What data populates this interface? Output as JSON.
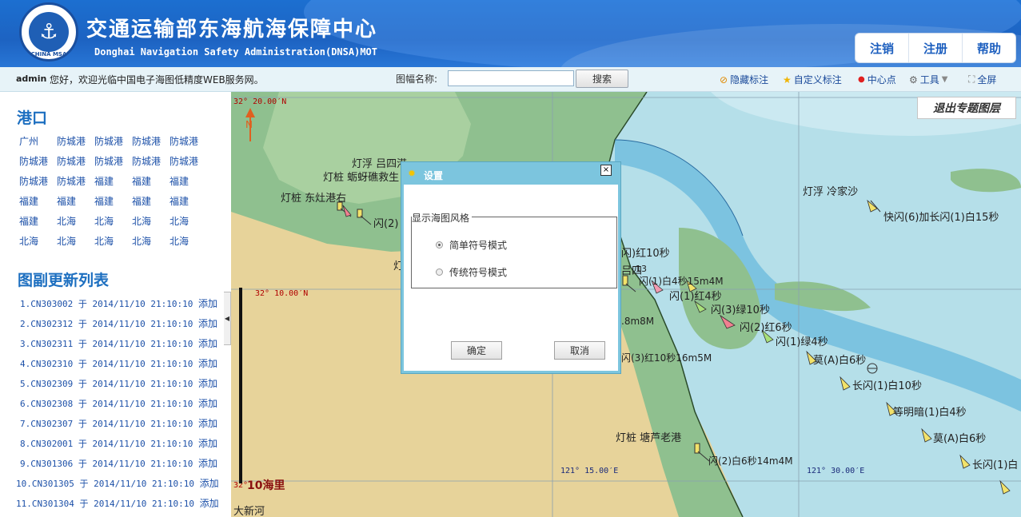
{
  "header": {
    "logo_text": "CHINA MSA",
    "title": "交通运输部东海航海保障中心",
    "subtitle": "Donghai Navigation Safety Administration(DNSA)MOT",
    "buttons": [
      "注销",
      "注册",
      "帮助"
    ]
  },
  "toolbar": {
    "user": "admin",
    "welcome": "您好，欢迎光临中国电子海图低精度WEB服务网。",
    "search_label": "图幅名称:",
    "search_value": "",
    "search_button": "搜索",
    "tools": [
      {
        "icon": "hide-marker-icon",
        "label": "隐藏标注"
      },
      {
        "icon": "star-icon",
        "label": "自定义标注"
      },
      {
        "icon": "red-dot-icon",
        "label": "中心点"
      },
      {
        "icon": "tools-icon",
        "label": "工具"
      },
      {
        "icon": "fullscreen-icon",
        "label": "全屏"
      }
    ]
  },
  "sidebar": {
    "ports_title": "港口",
    "ports": [
      "广州",
      "防城港",
      "防城港",
      "防城港",
      "防城港",
      "防城港",
      "防城港",
      "防城港",
      "防城港",
      "防城港",
      "防城港",
      "防城港",
      "福建",
      "福建",
      "福建",
      "福建",
      "福建",
      "福建",
      "福建",
      "福建",
      "福建",
      "北海",
      "北海",
      "北海",
      "北海",
      "北海",
      "北海",
      "北海",
      "北海",
      "北海"
    ],
    "updates_title": "图副更新列表",
    "updates": [
      {
        "index": "1.",
        "chart": "CN303002",
        "time": "于 2014/11/10 21:10:10",
        "action": "添加"
      },
      {
        "index": "2.",
        "chart": "CN302312",
        "time": "于 2014/11/10 21:10:10",
        "action": "添加"
      },
      {
        "index": "3.",
        "chart": "CN302311",
        "time": "于 2014/11/10 21:10:10",
        "action": "添加"
      },
      {
        "index": "4.",
        "chart": "CN302310",
        "time": "于 2014/11/10 21:10:10",
        "action": "添加"
      },
      {
        "index": "5.",
        "chart": "CN302309",
        "time": "于 2014/11/10 21:10:10",
        "action": "添加"
      },
      {
        "index": "6.",
        "chart": "CN302308",
        "time": "于 2014/11/10 21:10:10",
        "action": "添加"
      },
      {
        "index": "7.",
        "chart": "CN302307",
        "time": "于 2014/11/10 21:10:10",
        "action": "添加"
      },
      {
        "index": "8.",
        "chart": "CN302001",
        "time": "于 2014/11/10 21:10:10",
        "action": "添加"
      },
      {
        "index": "9.",
        "chart": "CN301306",
        "time": "于 2014/11/10 21:10:10",
        "action": "添加"
      },
      {
        "index": "10.",
        "chart": "CN301305",
        "time": "于 2014/11/10 21:10:10",
        "action": "添加"
      },
      {
        "index": "11.",
        "chart": "CN301304",
        "time": "于 2014/11/10 21:10:10",
        "action": "添加"
      }
    ]
  },
  "map": {
    "exit_button": "退出专题图层",
    "north_label": "N",
    "scale_label": "10海里",
    "coords": {
      "lat_top": "32° 20.00′N",
      "lat_mid": "32° 10.00′N",
      "lat_bottom": "32°",
      "lon_1": "121° 15.00′E",
      "lon_2": "121° 30.00′E"
    },
    "labels": [
      "灯浮 吕四港",
      "灯桩 蛎蚜礁救生",
      "灯桩 东灶港右",
      "闪(2)",
      "灯浮 冷家沙",
      "快闪(6)加长闪(1)白15秒",
      "闪)红10秒",
      "吕四",
      "13",
      "闪(1)白4秒15m4M",
      "闪(1)红4秒",
      "闪(3)绿10秒",
      "闪(2)红6秒",
      "闪(1)绿4秒",
      "莫(A)白6秒",
      "长闪(1)白10秒",
      "等明暗(1)白4秒",
      "莫(A)白6秒",
      "长闪(1)白",
      "灯桩 塘芦老港",
      "闪(2)白6秒14m4M",
      "闪(3)红10秒16m5M",
      ".8m8M",
      "灯",
      "大新河"
    ]
  },
  "dialog": {
    "title": "设置",
    "close": "×",
    "group_label": "显示海图风格",
    "options": [
      {
        "label": "简单符号模式",
        "checked": true
      },
      {
        "label": "传统符号模式",
        "checked": false
      }
    ],
    "ok": "确定",
    "cancel": "取消"
  },
  "colors": {
    "header_blue": "#1d63c2",
    "land_green": "#8fc08f",
    "land_tan": "#e7d39a",
    "sea_blue": "#b5dfe9",
    "shoal_blue": "#7cc3e0",
    "link_blue": "#1c50a8",
    "dialog_frame": "#7cc5de"
  }
}
